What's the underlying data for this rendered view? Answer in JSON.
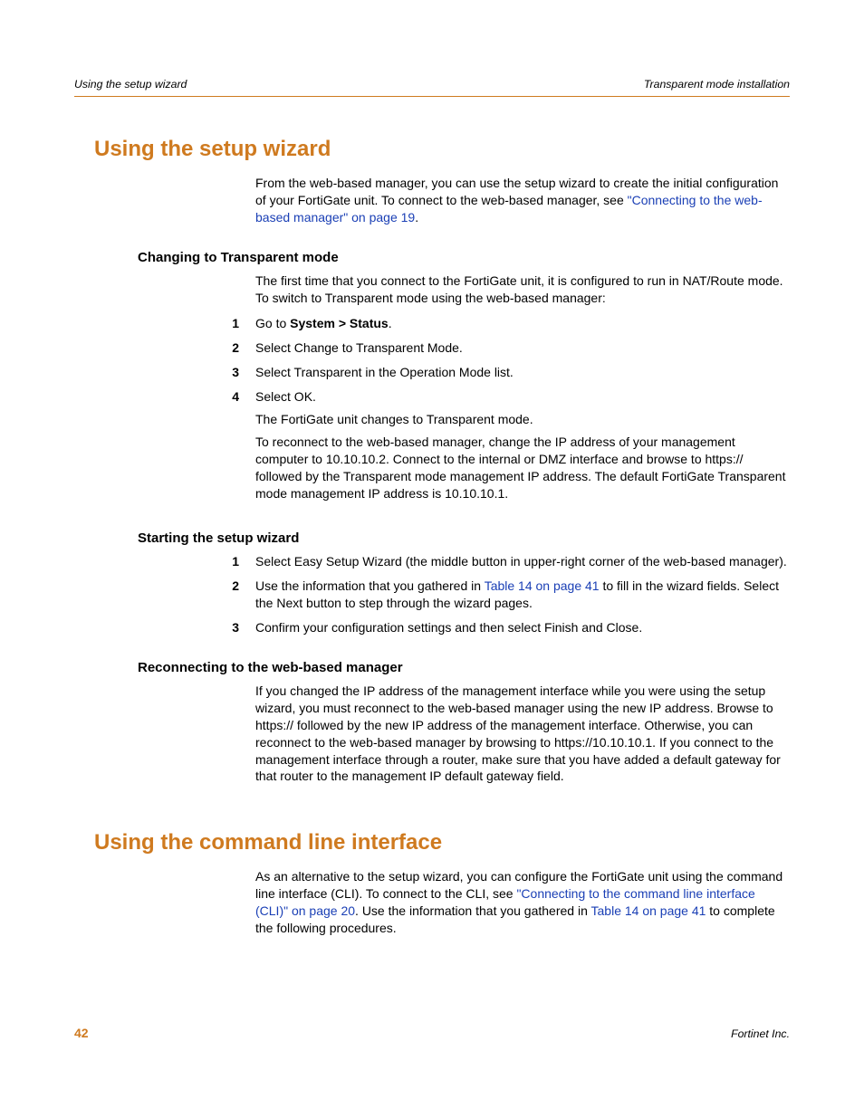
{
  "header": {
    "left": "Using the setup wizard",
    "right": "Transparent mode installation"
  },
  "section1": {
    "title": "Using the setup wizard",
    "intro_pre": "From the web-based manager, you can use the setup wizard to create the initial configuration of your FortiGate unit. To connect to the web-based manager, see ",
    "intro_link": "\"Connecting to the web-based manager\" on page 19",
    "intro_post": ".",
    "sub1": {
      "title": "Changing to Transparent mode",
      "lead": "The first time that you connect to the FortiGate unit, it is configured to run in NAT/Route mode. To switch to Transparent mode using the web-based manager:",
      "steps": {
        "s1_pre": "Go to ",
        "s1_bold": "System > Status",
        "s1_post": ".",
        "s2": "Select Change to Transparent Mode.",
        "s3": "Select Transparent in the Operation Mode list.",
        "s4": "Select OK.",
        "s4_follow1": "The FortiGate unit changes to Transparent mode.",
        "s4_follow2": "To reconnect to the web-based manager, change the IP address of your management computer to 10.10.10.2. Connect to the internal or DMZ interface and browse to https:// followed by the Transparent mode management IP address. The default FortiGate Transparent mode management IP address is 10.10.10.1."
      }
    },
    "sub2": {
      "title": "Starting the setup wizard",
      "steps": {
        "s1": "Select Easy Setup Wizard (the middle button in upper-right corner of the web-based manager).",
        "s2_pre": "Use the information that you gathered in ",
        "s2_link": "Table 14 on page 41",
        "s2_post": " to fill in the wizard fields. Select the Next button to step through the wizard pages.",
        "s3": "Confirm your configuration settings and then select Finish and Close."
      }
    },
    "sub3": {
      "title": "Reconnecting to the web-based manager",
      "body": "If you changed the IP address of the management interface while you were using the setup wizard, you must reconnect to the web-based manager using the new IP address. Browse to https:// followed by the new IP address of the management interface. Otherwise, you can reconnect to the web-based manager by browsing to https://10.10.10.1. If you connect to the management interface through a router, make sure that you have added a default gateway for that router to the management IP default gateway field."
    }
  },
  "section2": {
    "title": "Using the command line interface",
    "body_pre": "As an alternative to the setup wizard, you can configure the FortiGate unit using the command line interface (CLI). To connect to the CLI, see ",
    "body_link1": "\"Connecting to the command line interface (CLI)\" on page 20",
    "body_mid": ". Use the information that you gathered in ",
    "body_link2": "Table 14 on page 41",
    "body_post": " to complete the following procedures."
  },
  "footer": {
    "page": "42",
    "company": "Fortinet Inc."
  }
}
